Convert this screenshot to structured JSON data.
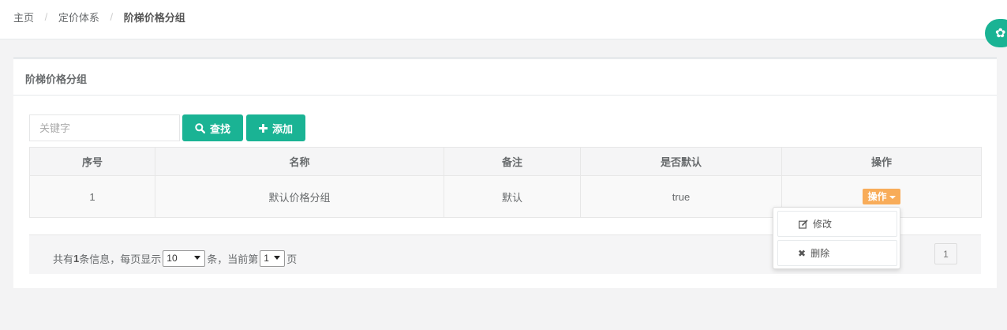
{
  "breadcrumb": {
    "home": "主页",
    "section": "定价体系",
    "current": "阶梯价格分组"
  },
  "panel": {
    "title": "阶梯价格分组"
  },
  "toolbar": {
    "search_placeholder": "关键字",
    "search_label": "查找",
    "add_label": "添加"
  },
  "table": {
    "columns": [
      "序号",
      "名称",
      "备注",
      "是否默认",
      "操作"
    ],
    "rows": [
      {
        "index": "1",
        "name": "默认价格分组",
        "remark": "默认",
        "is_default": "true",
        "action_label": "操作"
      }
    ]
  },
  "dropdown": {
    "edit_label": "修改",
    "delete_label": "删除"
  },
  "pager": {
    "total_prefix": "共有",
    "total_count": "1",
    "total_suffix": "条信息，每页显示",
    "page_size": "10",
    "mid_text": "条，当前第",
    "current_page": "1",
    "end_text": "页",
    "page_button": "1"
  },
  "colors": {
    "primary": "#1ab394",
    "warning": "#f8ac59"
  }
}
